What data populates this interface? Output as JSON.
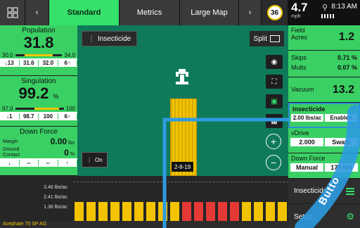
{
  "topbar": {
    "tabs": [
      {
        "label": "Standard",
        "active": true
      },
      {
        "label": "Metrics",
        "active": false
      },
      {
        "label": "Large Map",
        "active": false
      }
    ],
    "count_badge": "36"
  },
  "status": {
    "speed": "4.7",
    "speed_unit": "mph",
    "clock": "8:13 AM"
  },
  "left": {
    "population": {
      "title": "Population",
      "value": "31.8",
      "min": "30.0",
      "max": "34.0",
      "stats": [
        "↓13",
        "31.6",
        "32.0",
        "6↑"
      ]
    },
    "singulation": {
      "title": "Singulation",
      "value": "99.2",
      "unit": "%",
      "min": "97.0",
      "max": "100",
      "stats": [
        "↓1",
        "98.7",
        "100",
        "6↑"
      ]
    },
    "down_force": {
      "title": "Down Force",
      "margin_label": "Margin",
      "margin_value": "0.00",
      "margin_unit": "lbs",
      "gc_label_1": "Ground",
      "gc_label_2": "Contact",
      "gc_value": "0",
      "gc_unit": "%",
      "stats": [
        "↓",
        "--",
        "--",
        "↑"
      ]
    }
  },
  "map": {
    "layer_label": "Insecticide",
    "split_label": "Split",
    "tag": "2-8-19",
    "on_label": "On"
  },
  "right": {
    "field_acres_label_1": "Field",
    "field_acres_label_2": "Acres",
    "field_acres_value": "1.2",
    "skips_label": "Skips",
    "skips_value": "0.71 %",
    "mults_label": "Mults",
    "mults_value": "0.07 %",
    "vacuum_label": "Vacuum",
    "vacuum_value": "13.2",
    "insecticide_label": "Insecticide",
    "insecticide_rate": "2.00 lbs/ac",
    "insecticide_status": "Enabled",
    "vdrive_label": "vDrive",
    "vdrive_value": "2.000",
    "vdrive_mode": "Swath",
    "df_label": "Down Force",
    "df_mode": "Manual",
    "df_value": "170 lbs",
    "menu_label": "Insecticide",
    "setup_label": "Setup"
  },
  "bottom": {
    "ylabels": [
      "3.46 lbs/ac",
      "2.41 lbs/ac",
      "1.36 lbs/ac"
    ],
    "footer": "Acephate 75 SP AG",
    "bar_colors": [
      "#f3c300",
      "#f3c300",
      "#f3c300",
      "#f3c300",
      "#f3c300",
      "#f3c300",
      "#f3c300",
      "#f3c300",
      "#f3c300",
      "#e53935",
      "#e53935",
      "#e53935",
      "#e53935",
      "#e53935",
      "#f3c300",
      "#f3c300",
      "#f3c300",
      "#f3c300"
    ],
    "bar_levels": [
      0.5,
      0.5,
      0.5,
      0.5,
      0.5,
      0.5,
      0.5,
      0.5,
      0.5,
      0.5,
      0.5,
      0.5,
      0.5,
      0.5,
      0.5,
      0.5,
      0.5,
      0.5
    ]
  },
  "overlay": {
    "text": "Butto",
    "color": "#2e9be0"
  }
}
